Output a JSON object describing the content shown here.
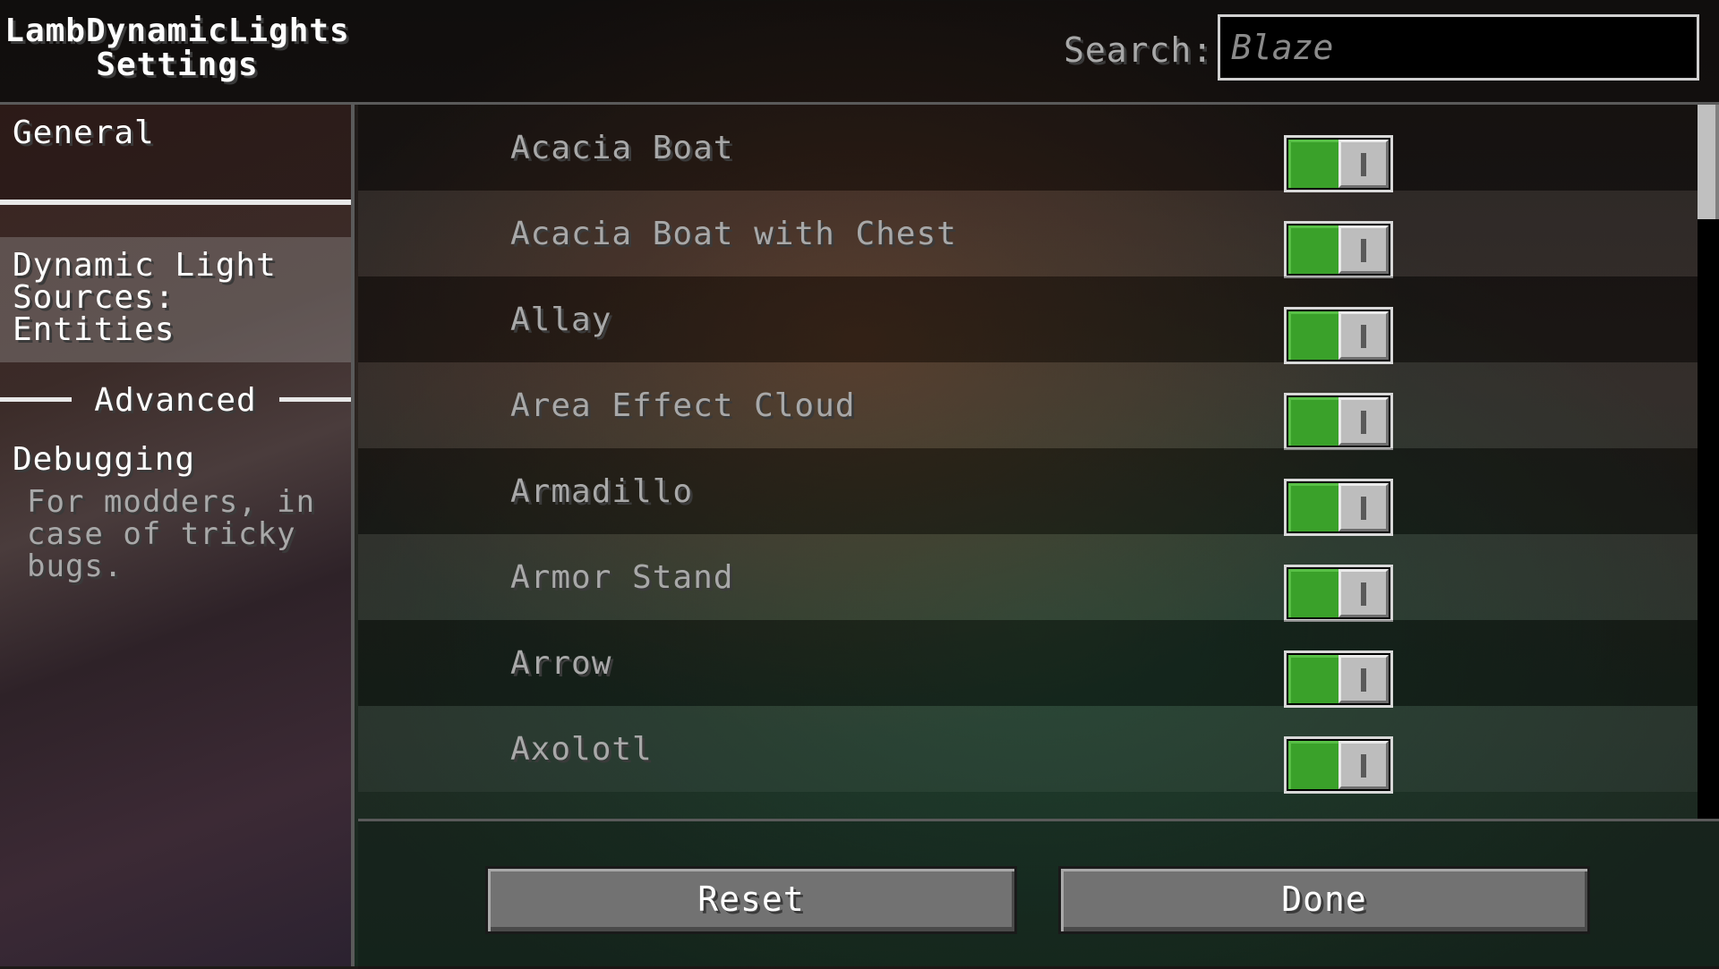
{
  "header": {
    "title_line1": "LambDynamicLights",
    "title_line2": "Settings",
    "search_label": "Search:",
    "search_value": "Blaze"
  },
  "sidebar": {
    "general": "General",
    "entities_line1": "Dynamic Light",
    "entities_line2": "Sources:",
    "entities_line3": "Entities",
    "advanced_heading": "Advanced",
    "debugging": "Debugging",
    "debugging_description": "For modders, in case of tricky bugs."
  },
  "entities": [
    {
      "label": "Acacia Boat",
      "enabled": true
    },
    {
      "label": "Acacia Boat with Chest",
      "enabled": true
    },
    {
      "label": "Allay",
      "enabled": true
    },
    {
      "label": "Area Effect Cloud",
      "enabled": true
    },
    {
      "label": "Armadillo",
      "enabled": true
    },
    {
      "label": "Armor Stand",
      "enabled": true
    },
    {
      "label": "Arrow",
      "enabled": true
    },
    {
      "label": "Axolotl",
      "enabled": true
    }
  ],
  "footer": {
    "reset_label": "Reset",
    "done_label": "Done"
  },
  "colors": {
    "toggle_on": "#3aa12a",
    "button_face": "#727272"
  }
}
